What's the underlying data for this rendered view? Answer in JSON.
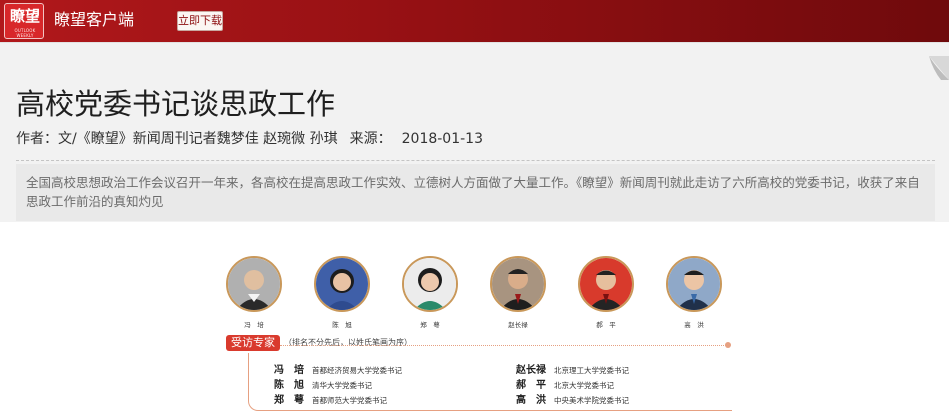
{
  "header": {
    "logo_text": "瞭望",
    "logo_subtext": "OUTLOOK WEEKLY",
    "app_name": "瞭望客户端",
    "download_label": "立即下载",
    "brand_color": "#a3141a"
  },
  "article": {
    "title": "高校党委书记谈思政工作",
    "author_label": "作者：",
    "author": "文/《瞭望》新闻周刊记者魏梦佳 赵琬微 孙琪",
    "source_label": "来源：",
    "source": "",
    "date": "2018-01-13",
    "summary": "全国高校思想政治工作会议召开一年来，各高校在提高思政工作实效、立德树人方面做了大量工作。《瞭望》新闻周刊就此走访了六所高校的党委书记，收获了来自思政工作前沿的真知灼见"
  },
  "figure": {
    "portraits": [
      {
        "name": "冯　培",
        "icon": "portrait-photo",
        "bg": "#a8a8a8"
      },
      {
        "name": "陈　旭",
        "icon": "portrait-photo",
        "bg": "#3f5fa8"
      },
      {
        "name": "郑　萼",
        "icon": "portrait-photo",
        "bg": "#e8e8e8"
      },
      {
        "name": "赵长禄",
        "icon": "portrait-photo",
        "bg": "#a89480"
      },
      {
        "name": "郝　平",
        "icon": "portrait-photo",
        "bg": "#d83a2c"
      },
      {
        "name": "高　洪",
        "icon": "portrait-photo",
        "bg": "#8fa8c8"
      }
    ],
    "badge": "受访专家",
    "badge_note": "（排名不分先后，以姓氏笔画为序）",
    "experts": [
      {
        "name": "冯　培",
        "role": "首都经济贸易大学党委书记"
      },
      {
        "name": "陈　旭",
        "role": "清华大学党委书记"
      },
      {
        "name": "郑　萼",
        "role": "首都师范大学党委书记"
      },
      {
        "name": "赵长禄",
        "role": "北京理工大学党委书记"
      },
      {
        "name": "郝　平",
        "role": "北京大学党委书记"
      },
      {
        "name": "高　洪",
        "role": "中央美术学院党委书记"
      }
    ]
  }
}
